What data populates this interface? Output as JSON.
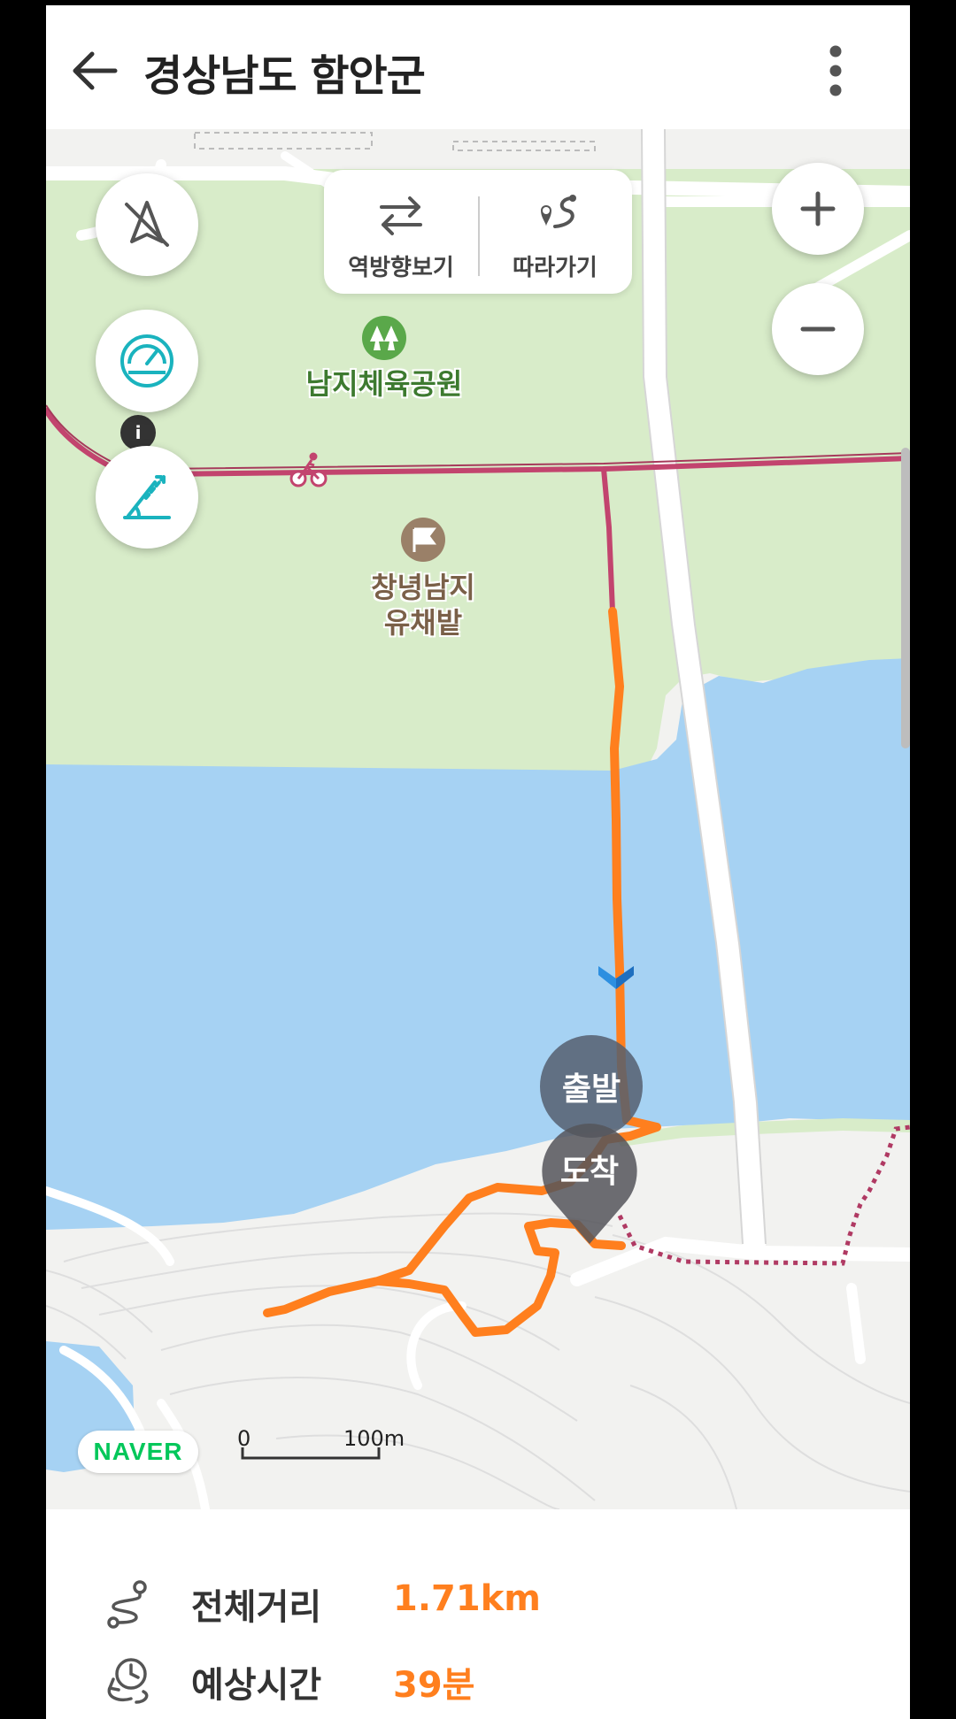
{
  "header": {
    "title": "경상남도 함안군"
  },
  "map": {
    "segment": {
      "reverse_label": "역방향보기",
      "follow_label": "따라가기"
    },
    "pois": {
      "park": "남지체육공원",
      "field": "창녕남지\n유채밭"
    },
    "markers": {
      "start": "출발",
      "end": "도착"
    },
    "brand": "NAVER",
    "scale": {
      "zero": "0",
      "label": "100m"
    },
    "icons": {
      "compass_off": "compass-off-icon",
      "speedometer": "speedometer-icon",
      "elevation": "elevation-icon",
      "zoom_in": "plus-icon",
      "zoom_out": "minus-icon",
      "bike": "bicycle-icon",
      "park": "tree-icon",
      "flag": "flag-icon"
    }
  },
  "summary": {
    "distance_label": "전체거리",
    "distance_value": "1.71km",
    "time_label": "예상시간",
    "time_value": "39분"
  },
  "colors": {
    "route": "#ff7f1e",
    "bike_path": "#c2446e",
    "water": "#a6d2f3",
    "park": "#d8ecc9",
    "accent_teal": "#1ab3be",
    "value_orange": "#ff7f1e"
  }
}
